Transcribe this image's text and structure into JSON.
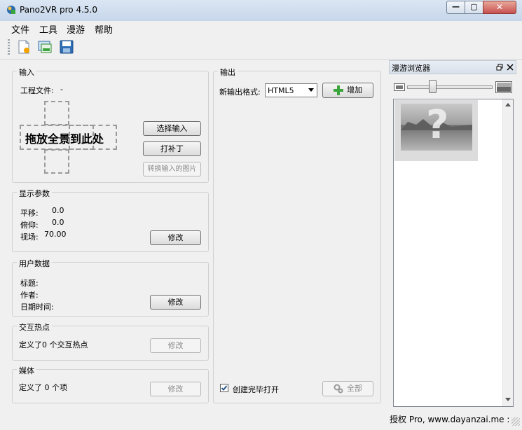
{
  "window": {
    "title": "Pano2VR pro 4.5.0",
    "min_glyph": "—",
    "max_glyph": "▢",
    "close_glyph": "✕"
  },
  "menu": [
    "文件",
    "工具",
    "漫游",
    "帮助"
  ],
  "input_group": {
    "title": "输入",
    "project_label": "工程文件:",
    "project_value": "-",
    "drop_text": "拖放全景到此处",
    "select_input": "选择输入",
    "patch": "打补丁",
    "convert": "转换输入的图片"
  },
  "display_group": {
    "title": "显示参数",
    "pan_label": "平移:",
    "pan_value": "0.0",
    "tilt_label": "俯仰:",
    "tilt_value": "0.0",
    "fov_label": "视场:",
    "fov_value": "70.00",
    "modify": "修改"
  },
  "user_group": {
    "title": "用户数据",
    "title_label": "标题:",
    "author_label": "作者:",
    "date_label": "日期时间:",
    "modify": "修改"
  },
  "hotspot_group": {
    "title": "交互热点",
    "text": "定义了0 个交互热点",
    "modify": "修改"
  },
  "media_group": {
    "title": "媒体",
    "text": "定义了 0 个项",
    "modify": "修改"
  },
  "output_group": {
    "title": "输出",
    "format_label": "新输出格式:",
    "format_value": "HTML5",
    "add": "增加",
    "open_label": "创建完毕打开",
    "open_checked": true,
    "all": "全部"
  },
  "tour_browser": {
    "title": "漫游浏览器",
    "thumb_symbol": "?",
    "zoom_level": 0.3
  },
  "status": {
    "text": "授权 Pro, www.dayanzai.me :"
  },
  "colors": {
    "accent_green": "#3aa53a",
    "titlebar": "#c6d6ea",
    "close_red": "#c75050"
  }
}
